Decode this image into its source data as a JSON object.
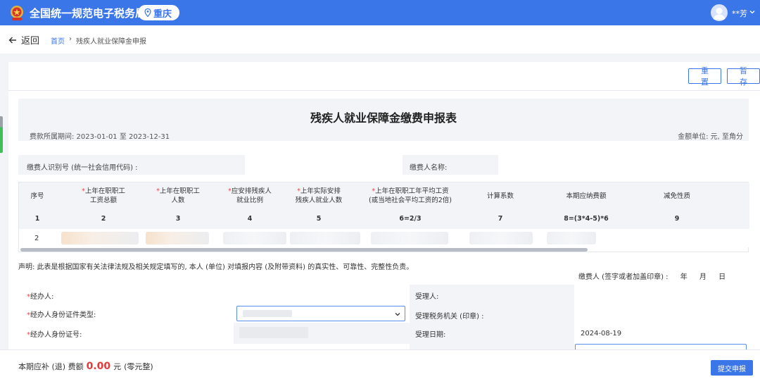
{
  "header": {
    "app_title": "全国统一规范电子税务局",
    "region": "重庆",
    "username": "**芳"
  },
  "nav": {
    "back_label": "返回",
    "breadcrumb_home": "首页",
    "breadcrumb_sep": "›",
    "breadcrumb_current": "残疾人就业保障金申报"
  },
  "actions": {
    "reset_label": "重置",
    "save_draft_label": "暂存"
  },
  "form": {
    "title": "残疾人就业保障金缴费申报表",
    "period": "费款所属期间:  2023-01-01 至 2023-12-31",
    "unit": "金额单位: 元, 至角分",
    "taxpayer_id_label": "缴费人识别号 (统一社会信用代码) :",
    "taxpayer_name_label": "缴费人名称:"
  },
  "table": {
    "columns": [
      {
        "req": "",
        "label": "序号",
        "num": "1"
      },
      {
        "req": "*",
        "label": "上年在职职工\n工资总额",
        "num": "2"
      },
      {
        "req": "*",
        "label": "上年在职职工\n人数",
        "num": "3"
      },
      {
        "req": "*",
        "label": "应安排残疾人\n就业比例",
        "num": "4"
      },
      {
        "req": "*",
        "label": "上年实际安排\n残疾人就业人数",
        "num": "5"
      },
      {
        "req": "*",
        "label": "上年在职职工年平均工资\n(或当地社会平均工资的2倍)",
        "num": "6=2/3"
      },
      {
        "req": "",
        "label": "计算系数",
        "num": "7"
      },
      {
        "req": "",
        "label": "本期应纳费额",
        "num": "8=(3*4-5)*6"
      },
      {
        "req": "",
        "label": "减免性质",
        "num": "9"
      }
    ],
    "row_number": "2"
  },
  "declaration": {
    "statement": "声明: 此表是根据国家有关法律法规及相关规定填写的, 本人 (单位) 对填报内容 (及附带资料) 的真实性、可靠性、完整性负责。",
    "signer_label": "缴费人 (签字或者加盖印章) :",
    "year": "年",
    "month": "月",
    "day": "日"
  },
  "agent": {
    "handler_label": "经办人:",
    "id_type_label": "经办人身份证件类型:",
    "id_number_label": "经办人身份证号:",
    "required_mark": "*",
    "receiver_label": "受理人:",
    "tax_authority_label": "受理税务机关 (印章) :",
    "receipt_date_label": "受理日期:",
    "receipt_date": "2024-08-19"
  },
  "footer": {
    "prefix": "本期应补 (退) 费额",
    "amount": "0.00",
    "currency": "元",
    "amount_words": "(零元整)",
    "submit_label": "提交申报"
  },
  "colors": {
    "primary": "#3b76e8",
    "required": "#e24a4a",
    "amount": "#e23a3a"
  }
}
